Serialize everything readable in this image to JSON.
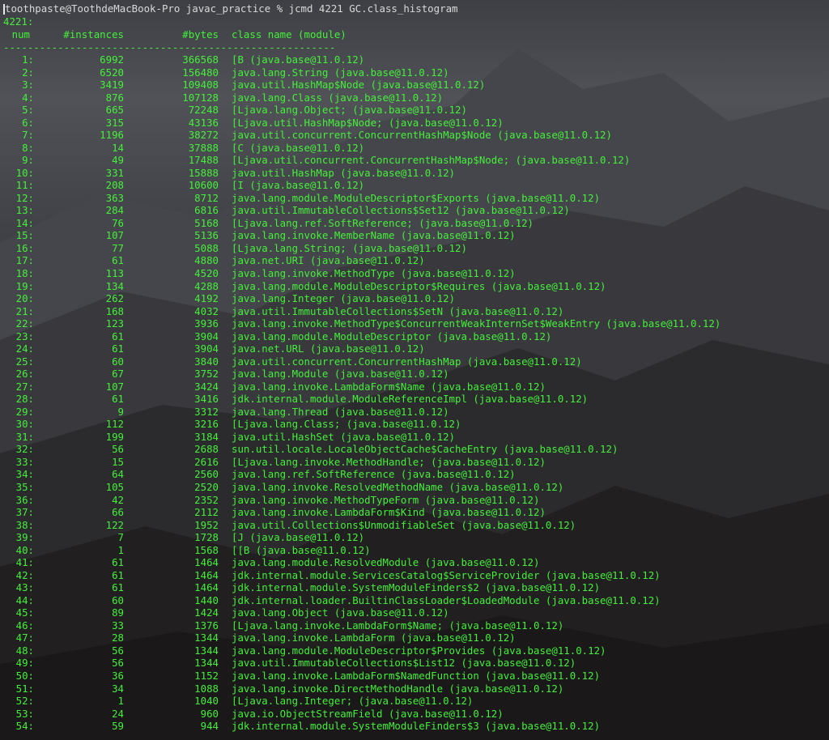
{
  "terminal": {
    "prompt": "toothpaste@ToothdeMacBook-Pro javac_practice % jcmd 4221 GC.class_histogram",
    "pid_line": "4221:",
    "headers": {
      "num": " num",
      "instances": "#instances",
      "bytes": "#bytes",
      "class_name": "class name (module)"
    },
    "separator": "-------------------------------------------------------"
  },
  "rows": [
    {
      "num": "1:",
      "instances": "6992",
      "bytes": "366568",
      "name": "[B (java.base@11.0.12)"
    },
    {
      "num": "2:",
      "instances": "6520",
      "bytes": "156480",
      "name": "java.lang.String (java.base@11.0.12)"
    },
    {
      "num": "3:",
      "instances": "3419",
      "bytes": "109408",
      "name": "java.util.HashMap$Node (java.base@11.0.12)"
    },
    {
      "num": "4:",
      "instances": "876",
      "bytes": "107128",
      "name": "java.lang.Class (java.base@11.0.12)"
    },
    {
      "num": "5:",
      "instances": "665",
      "bytes": "72248",
      "name": "[Ljava.lang.Object; (java.base@11.0.12)"
    },
    {
      "num": "6:",
      "instances": "315",
      "bytes": "43136",
      "name": "[Ljava.util.HashMap$Node; (java.base@11.0.12)"
    },
    {
      "num": "7:",
      "instances": "1196",
      "bytes": "38272",
      "name": "java.util.concurrent.ConcurrentHashMap$Node (java.base@11.0.12)"
    },
    {
      "num": "8:",
      "instances": "14",
      "bytes": "37888",
      "name": "[C (java.base@11.0.12)"
    },
    {
      "num": "9:",
      "instances": "49",
      "bytes": "17488",
      "name": "[Ljava.util.concurrent.ConcurrentHashMap$Node; (java.base@11.0.12)"
    },
    {
      "num": "10:",
      "instances": "331",
      "bytes": "15888",
      "name": "java.util.HashMap (java.base@11.0.12)"
    },
    {
      "num": "11:",
      "instances": "208",
      "bytes": "10600",
      "name": "[I (java.base@11.0.12)"
    },
    {
      "num": "12:",
      "instances": "363",
      "bytes": "8712",
      "name": "java.lang.module.ModuleDescriptor$Exports (java.base@11.0.12)"
    },
    {
      "num": "13:",
      "instances": "284",
      "bytes": "6816",
      "name": "java.util.ImmutableCollections$Set12 (java.base@11.0.12)"
    },
    {
      "num": "14:",
      "instances": "76",
      "bytes": "5168",
      "name": "[Ljava.lang.ref.SoftReference; (java.base@11.0.12)"
    },
    {
      "num": "15:",
      "instances": "107",
      "bytes": "5136",
      "name": "java.lang.invoke.MemberName (java.base@11.0.12)"
    },
    {
      "num": "16:",
      "instances": "77",
      "bytes": "5088",
      "name": "[Ljava.lang.String; (java.base@11.0.12)"
    },
    {
      "num": "17:",
      "instances": "61",
      "bytes": "4880",
      "name": "java.net.URI (java.base@11.0.12)"
    },
    {
      "num": "18:",
      "instances": "113",
      "bytes": "4520",
      "name": "java.lang.invoke.MethodType (java.base@11.0.12)"
    },
    {
      "num": "19:",
      "instances": "134",
      "bytes": "4288",
      "name": "java.lang.module.ModuleDescriptor$Requires (java.base@11.0.12)"
    },
    {
      "num": "20:",
      "instances": "262",
      "bytes": "4192",
      "name": "java.lang.Integer (java.base@11.0.12)"
    },
    {
      "num": "21:",
      "instances": "168",
      "bytes": "4032",
      "name": "java.util.ImmutableCollections$SetN (java.base@11.0.12)"
    },
    {
      "num": "22:",
      "instances": "123",
      "bytes": "3936",
      "name": "java.lang.invoke.MethodType$ConcurrentWeakInternSet$WeakEntry (java.base@11.0.12)"
    },
    {
      "num": "23:",
      "instances": "61",
      "bytes": "3904",
      "name": "java.lang.module.ModuleDescriptor (java.base@11.0.12)"
    },
    {
      "num": "24:",
      "instances": "61",
      "bytes": "3904",
      "name": "java.net.URL (java.base@11.0.12)"
    },
    {
      "num": "25:",
      "instances": "60",
      "bytes": "3840",
      "name": "java.util.concurrent.ConcurrentHashMap (java.base@11.0.12)"
    },
    {
      "num": "26:",
      "instances": "67",
      "bytes": "3752",
      "name": "java.lang.Module (java.base@11.0.12)"
    },
    {
      "num": "27:",
      "instances": "107",
      "bytes": "3424",
      "name": "java.lang.invoke.LambdaForm$Name (java.base@11.0.12)"
    },
    {
      "num": "28:",
      "instances": "61",
      "bytes": "3416",
      "name": "jdk.internal.module.ModuleReferenceImpl (java.base@11.0.12)"
    },
    {
      "num": "29:",
      "instances": "9",
      "bytes": "3312",
      "name": "java.lang.Thread (java.base@11.0.12)"
    },
    {
      "num": "30:",
      "instances": "112",
      "bytes": "3216",
      "name": "[Ljava.lang.Class; (java.base@11.0.12)"
    },
    {
      "num": "31:",
      "instances": "199",
      "bytes": "3184",
      "name": "java.util.HashSet (java.base@11.0.12)"
    },
    {
      "num": "32:",
      "instances": "56",
      "bytes": "2688",
      "name": "sun.util.locale.LocaleObjectCache$CacheEntry (java.base@11.0.12)"
    },
    {
      "num": "33:",
      "instances": "15",
      "bytes": "2616",
      "name": "[Ljava.lang.invoke.MethodHandle; (java.base@11.0.12)"
    },
    {
      "num": "34:",
      "instances": "64",
      "bytes": "2560",
      "name": "java.lang.ref.SoftReference (java.base@11.0.12)"
    },
    {
      "num": "35:",
      "instances": "105",
      "bytes": "2520",
      "name": "java.lang.invoke.ResolvedMethodName (java.base@11.0.12)"
    },
    {
      "num": "36:",
      "instances": "42",
      "bytes": "2352",
      "name": "java.lang.invoke.MethodTypeForm (java.base@11.0.12)"
    },
    {
      "num": "37:",
      "instances": "66",
      "bytes": "2112",
      "name": "java.lang.invoke.LambdaForm$Kind (java.base@11.0.12)"
    },
    {
      "num": "38:",
      "instances": "122",
      "bytes": "1952",
      "name": "java.util.Collections$UnmodifiableSet (java.base@11.0.12)"
    },
    {
      "num": "39:",
      "instances": "7",
      "bytes": "1728",
      "name": "[J (java.base@11.0.12)"
    },
    {
      "num": "40:",
      "instances": "1",
      "bytes": "1568",
      "name": "[[B (java.base@11.0.12)"
    },
    {
      "num": "41:",
      "instances": "61",
      "bytes": "1464",
      "name": "java.lang.module.ResolvedModule (java.base@11.0.12)"
    },
    {
      "num": "42:",
      "instances": "61",
      "bytes": "1464",
      "name": "jdk.internal.module.ServicesCatalog$ServiceProvider (java.base@11.0.12)"
    },
    {
      "num": "43:",
      "instances": "61",
      "bytes": "1464",
      "name": "jdk.internal.module.SystemModuleFinders$2 (java.base@11.0.12)"
    },
    {
      "num": "44:",
      "instances": "60",
      "bytes": "1440",
      "name": "jdk.internal.loader.BuiltinClassLoader$LoadedModule (java.base@11.0.12)"
    },
    {
      "num": "45:",
      "instances": "89",
      "bytes": "1424",
      "name": "java.lang.Object (java.base@11.0.12)"
    },
    {
      "num": "46:",
      "instances": "33",
      "bytes": "1376",
      "name": "[Ljava.lang.invoke.LambdaForm$Name; (java.base@11.0.12)"
    },
    {
      "num": "47:",
      "instances": "28",
      "bytes": "1344",
      "name": "java.lang.invoke.LambdaForm (java.base@11.0.12)"
    },
    {
      "num": "48:",
      "instances": "56",
      "bytes": "1344",
      "name": "java.lang.module.ModuleDescriptor$Provides (java.base@11.0.12)"
    },
    {
      "num": "49:",
      "instances": "56",
      "bytes": "1344",
      "name": "java.util.ImmutableCollections$List12 (java.base@11.0.12)"
    },
    {
      "num": "50:",
      "instances": "36",
      "bytes": "1152",
      "name": "java.lang.invoke.LambdaForm$NamedFunction (java.base@11.0.12)"
    },
    {
      "num": "51:",
      "instances": "34",
      "bytes": "1088",
      "name": "java.lang.invoke.DirectMethodHandle (java.base@11.0.12)"
    },
    {
      "num": "52:",
      "instances": "1",
      "bytes": "1040",
      "name": "[Ljava.lang.Integer; (java.base@11.0.12)"
    },
    {
      "num": "53:",
      "instances": "24",
      "bytes": "960",
      "name": "java.io.ObjectStreamField (java.base@11.0.12)"
    },
    {
      "num": "54:",
      "instances": "59",
      "bytes": "944",
      "name": "jdk.internal.module.SystemModuleFinders$3 (java.base@11.0.12)"
    }
  ],
  "colors": {
    "text_green": "#44f03a",
    "text_white": "#d9d9d9"
  }
}
